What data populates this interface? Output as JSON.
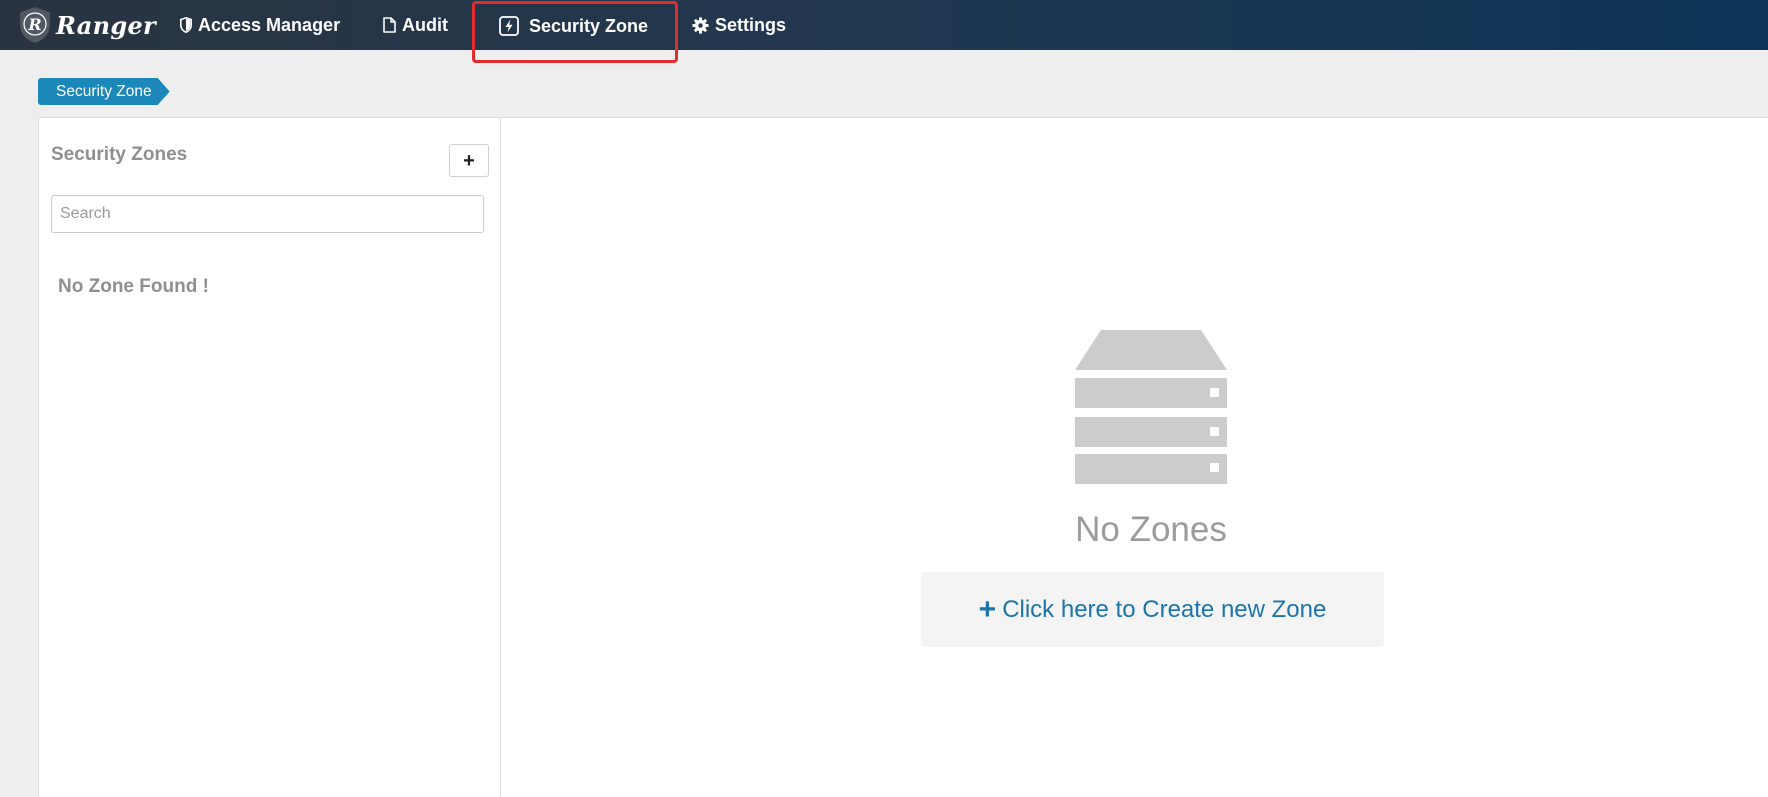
{
  "app": {
    "brand_name": "Ranger"
  },
  "nav": {
    "access_manager": "Access Manager",
    "audit": "Audit",
    "security_zone": "Security Zone",
    "settings": "Settings",
    "active_item": "security_zone",
    "icons": {
      "access_manager": "shield-icon",
      "audit": "file-icon",
      "security_zone": "bolt-icon",
      "settings": "gear-icon"
    }
  },
  "breadcrumb": {
    "current": "Security Zone"
  },
  "sidebar": {
    "title": "Security Zones",
    "add_button_label": "+",
    "search_placeholder": "Search",
    "empty_message": "No Zone Found !"
  },
  "main": {
    "empty_title": "No Zones",
    "create_prompt": "Click here to Create new Zone",
    "create_icon": "plus-icon"
  },
  "colors": {
    "topbar_start": "#2a3440",
    "topbar_end": "#0d3558",
    "breadcrumb": "#1c87b9",
    "link": "#1c74a8",
    "muted_text": "#8f8f8f",
    "highlight_border": "#e12d2d"
  }
}
